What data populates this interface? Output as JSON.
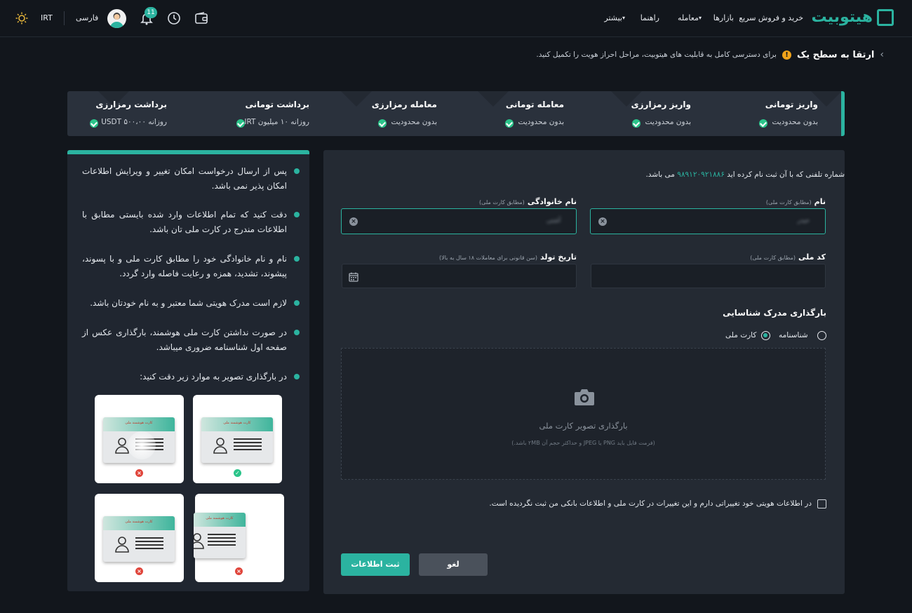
{
  "header": {
    "brand": "هیتوبیت",
    "nav": [
      "خرید و فروش سریع",
      "بازارها",
      "معامله",
      "راهنما",
      "بیشتر"
    ],
    "currency": "IRT",
    "language": "فارسی",
    "notification_count": "11",
    "icons": [
      "sun-icon",
      "bell-icon",
      "history-icon",
      "wallet-icon",
      "avatar"
    ]
  },
  "breadcrumb": {
    "title": "ارتقا به سطح یک",
    "message": "برای دسترسی کامل به قابلیت های هیتوبیت، مراحل احراز هویت را تکمیل کنید."
  },
  "limits": [
    {
      "title": "واریز تومانی",
      "value": "بدون محدودیت"
    },
    {
      "title": "واریز رمزارزی",
      "value": "بدون محدودیت"
    },
    {
      "title": "معامله تومانی",
      "value": "بدون محدودیت"
    },
    {
      "title": "معامله رمزارزی",
      "value": "بدون محدودیت"
    },
    {
      "title": "برداشت تومانی",
      "value": "روزانه ۱۰ میلیون IRT"
    },
    {
      "title": "برداشت رمزارزی",
      "value": "روزانه USDT ۵۰۰،۰۰"
    }
  ],
  "info": {
    "bullets": [
      "پس از ارسال درخواست امکان تغییر و ویرایش اطلاعات امکان پذیر نمی باشد.",
      "دقت کنید که تمام اطلاعات وارد شده بایستی مطابق با اطلاعات مندرج در کارت ملی تان باشد.",
      "نام و نام خانوادگی خود را مطابق کارت ملی و با پسوند، پیشوند، تشدید، همزه و رعایت فاصله وارد گردد.",
      "لازم است مدرک هویتی شما معتبر و به نام خودتان باشد.",
      "در صورت نداشتن کارت ملی هوشمند، بارگذاری عکس از صفحه اول شناسنامه ضروری میباشد.",
      "در بارگذاری تصویر به موارد زیر دقت کنید:"
    ],
    "card_title": "کارت هوشمند ملی"
  },
  "form": {
    "phone_prefix": "شماره تلفنی که با آن ثبت نام کرده اید",
    "phone": "۹۸۹۱۲۰۹۲۱۸۸۶",
    "phone_suffix": "می باشد.",
    "first_name_label": "نام",
    "first_name_hint": "(مطابق کارت ملی)",
    "first_name_value": "حیدر",
    "last_name_label": "نام خانوادگی",
    "last_name_hint": "(مطابق کارت ملی)",
    "last_name_value": "آشتی",
    "national_code_label": "کد ملی",
    "national_code_hint": "(مطابق کارت ملی)",
    "birth_label": "تاریخ تولد",
    "birth_hint": "(سن قانونی برای معاملات ۱۸ سال به بالا)",
    "upload_section": "بارگذاری مدرک شناسایی",
    "doc_options": [
      "کارت ملی",
      "شناسنامه"
    ],
    "doc_selected": "کارت ملی",
    "upload_title": "بارگذاری تصویر کارت ملی",
    "upload_hint": "(فرمت فایل باید PNG یا JPEG و حداکثر حجم آن ۲MB باشد.)",
    "checkbox_label": "در اطلاعات هویتی خود تغییراتی دارم و این تغییرات در کارت ملی و اطلاعات بانکی من ثبت نگردیده است.",
    "submit": "ثبت اطلاعات",
    "cancel": "لغو"
  }
}
